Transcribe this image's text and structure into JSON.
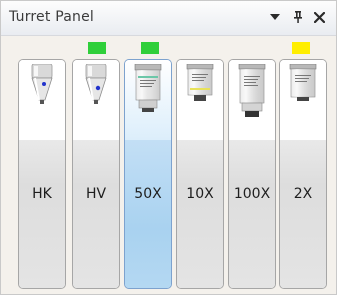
{
  "panel": {
    "title": "Turret Panel"
  },
  "titlebar_icons": [
    "dropdown-arrow-icon",
    "pin-icon",
    "close-icon"
  ],
  "colors": {
    "indicator_green": "#2fcf3a",
    "indicator_yellow": "#ffee00",
    "selected_fill": "#a9d2f0"
  },
  "slots": [
    {
      "label": "HK",
      "type": "indenter",
      "indicator": null
    },
    {
      "label": "HV",
      "type": "indenter",
      "indicator": "green"
    },
    {
      "label": "50X",
      "type": "objective",
      "indicator": "green",
      "selected": true
    },
    {
      "label": "10X",
      "type": "objective",
      "indicator": null
    },
    {
      "label": "100X",
      "type": "objective",
      "indicator": null
    },
    {
      "label": "2X",
      "type": "objective",
      "indicator": "yellow"
    }
  ]
}
